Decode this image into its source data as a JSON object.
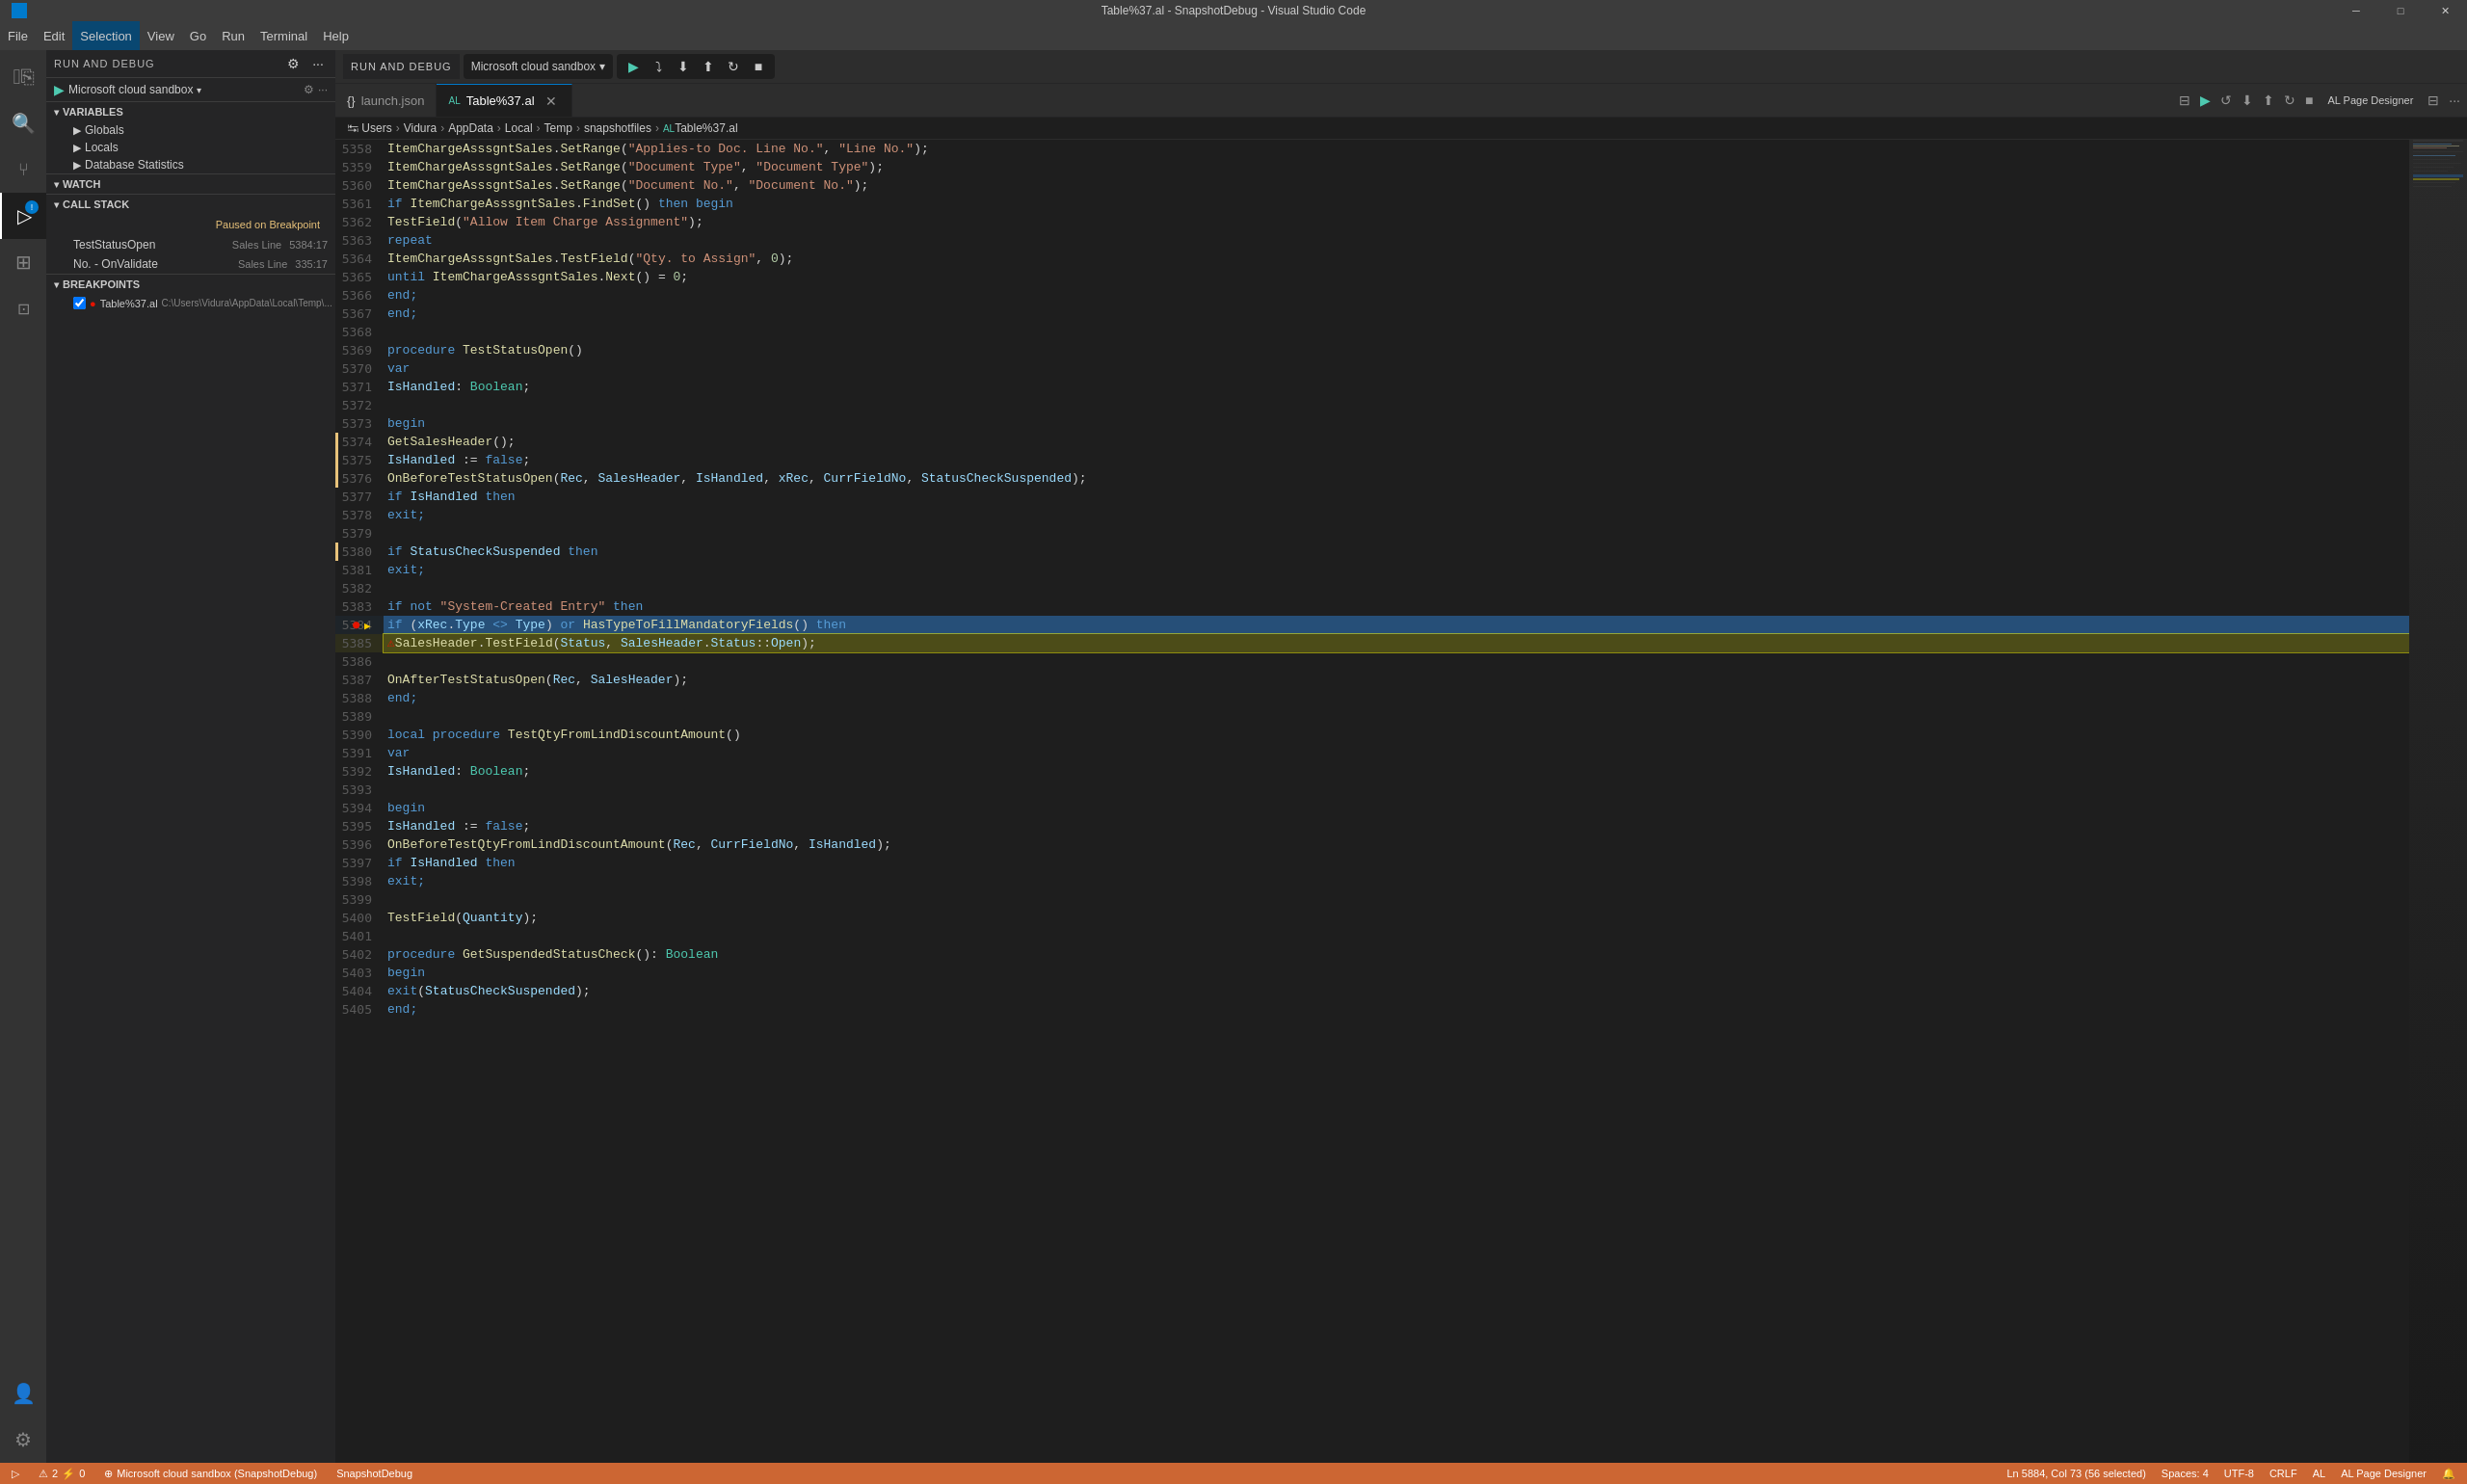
{
  "titleBar": {
    "title": "Table%37.al - SnapshotDebug - Visual Studio Code",
    "controls": [
      "minimize",
      "maximize",
      "close"
    ]
  },
  "menuBar": {
    "items": [
      "File",
      "Edit",
      "Selection",
      "View",
      "Go",
      "Run",
      "Terminal",
      "Help"
    ],
    "activeItem": "Selection"
  },
  "activityBar": {
    "items": [
      {
        "name": "explorer",
        "icon": "⎘",
        "active": false
      },
      {
        "name": "search",
        "icon": "🔍",
        "active": false
      },
      {
        "name": "source-control",
        "icon": "⑂",
        "active": false
      },
      {
        "name": "debug",
        "icon": "▷",
        "active": true
      },
      {
        "name": "extensions",
        "icon": "⊞",
        "active": false
      },
      {
        "name": "al-page-designer",
        "icon": "⊡",
        "active": false
      }
    ],
    "bottomItems": [
      {
        "name": "account",
        "icon": "👤"
      },
      {
        "name": "settings",
        "icon": "⚙"
      }
    ]
  },
  "sidebar": {
    "header": "RUN AND DEBUG",
    "config": "Microsoft cloud sandbox",
    "variables": {
      "title": "VARIABLES",
      "items": [
        {
          "name": "Globals",
          "expanded": false
        },
        {
          "name": "Locals",
          "expanded": false
        },
        {
          "name": "Database Statistics",
          "expanded": false
        }
      ]
    },
    "watch": {
      "title": "WATCH",
      "items": []
    },
    "callStack": {
      "title": "CALL STACK",
      "pausedLabel": "Paused on Breakpoint",
      "items": [
        {
          "funcName": "TestStatusOpen",
          "file": "Sales Line",
          "line": "5384:17"
        },
        {
          "funcName": "No. - OnValidate",
          "file": "Sales Line",
          "line": "335:17"
        }
      ]
    },
    "breakpoints": {
      "title": "BREAKPOINTS",
      "items": [
        {
          "name": "Table%37.al",
          "path": "C:\\Users\\Vidura\\AppData\\Local\\Temp\\...",
          "enabled": true,
          "hasError": true
        }
      ]
    }
  },
  "editor": {
    "tabs": [
      {
        "name": "launch.json",
        "icon": "{ }",
        "active": false
      },
      {
        "name": "Table%37.al",
        "icon": "AL",
        "active": true,
        "modified": false
      }
    ],
    "breadcrumb": [
      "Users",
      "Vidura",
      "AppData",
      "Local",
      "Temp",
      "snapshotfiles",
      "Table%37.al"
    ],
    "lines": [
      {
        "num": 5358,
        "text": "    ItemChargeAsssgntSales.SetRange(\"Applies-to Doc. Line No.\", \"Line No.\");"
      },
      {
        "num": 5359,
        "text": "    ItemChargeAsssgntSales.SetRange(\"Document Type\", \"Document Type\");"
      },
      {
        "num": 5360,
        "text": "    ItemChargeAsssgntSales.SetRange(\"Document No.\", \"Document No.\");"
      },
      {
        "num": 5361,
        "text": "    if ItemChargeAsssgntSales.FindSet() then begin"
      },
      {
        "num": 5362,
        "text": "        TestField(\"Allow Item Charge Assignment\");"
      },
      {
        "num": 5363,
        "text": "        repeat"
      },
      {
        "num": 5364,
        "text": "            ItemChargeAsssgntSales.TestField(\"Qty. to Assign\", 0);"
      },
      {
        "num": 5365,
        "text": "        until ItemChargeAsssgntSales.Next() = 0;"
      },
      {
        "num": 5366,
        "text": "    end;"
      },
      {
        "num": 5367,
        "text": "end;"
      },
      {
        "num": 5368,
        "text": ""
      },
      {
        "num": 5369,
        "text": "procedure TestStatusOpen()"
      },
      {
        "num": 5370,
        "text": "var"
      },
      {
        "num": 5371,
        "text": "    IsHandled: Boolean;"
      },
      {
        "num": 5372,
        "text": ""
      },
      {
        "num": 5373,
        "text": "begin"
      },
      {
        "num": 5374,
        "text": "    GetSalesHeader();"
      },
      {
        "num": 5375,
        "text": "    IsHandled := false;"
      },
      {
        "num": 5376,
        "text": "    OnBeforeTestStatusOpen(Rec, SalesHeader, IsHandled, xRec, CurrFieldNo, StatusCheckSuspended);"
      },
      {
        "num": 5377,
        "text": "    if IsHandled then"
      },
      {
        "num": 5378,
        "text": "        exit;"
      },
      {
        "num": 5379,
        "text": ""
      },
      {
        "num": 5380,
        "text": "    if StatusCheckSuspended then"
      },
      {
        "num": 5381,
        "text": "        exit;"
      },
      {
        "num": 5382,
        "text": ""
      },
      {
        "num": 5383,
        "text": "    if not \"System-Created Entry\" then"
      },
      {
        "num": 5384,
        "text": "        if (xRec.Type <> Type) or HasTypeToFillMandatoryFields() then",
        "breakpoint": true,
        "arrow": true,
        "highlight": true
      },
      {
        "num": 5385,
        "text": "            SalesHeader.TestField(Status, SalesHeader.Status::Open);"
      },
      {
        "num": 5386,
        "text": ""
      },
      {
        "num": 5387,
        "text": "    OnAfterTestStatusOpen(Rec, SalesHeader);"
      },
      {
        "num": 5388,
        "text": "end;"
      },
      {
        "num": 5389,
        "text": ""
      },
      {
        "num": 5390,
        "text": "local procedure TestQtyFromLindDiscountAmount()"
      },
      {
        "num": 5391,
        "text": "var"
      },
      {
        "num": 5392,
        "text": "    IsHandled: Boolean;"
      },
      {
        "num": 5393,
        "text": ""
      },
      {
        "num": 5394,
        "text": "begin"
      },
      {
        "num": 5395,
        "text": "    IsHandled := false;"
      },
      {
        "num": 5396,
        "text": "    OnBeforeTestQtyFromLindDiscountAmount(Rec, CurrFieldNo, IsHandled);"
      },
      {
        "num": 5397,
        "text": "    if IsHandled then"
      },
      {
        "num": 5398,
        "text": "        exit;"
      },
      {
        "num": 5399,
        "text": ""
      },
      {
        "num": 5400,
        "text": "    TestField(Quantity);"
      },
      {
        "num": 5401,
        "text": ""
      },
      {
        "num": 5402,
        "text": "procedure GetSuspendedStatusCheck(): Boolean"
      },
      {
        "num": 5403,
        "text": "begin"
      },
      {
        "num": 5404,
        "text": "    exit(StatusCheckSuspended);"
      },
      {
        "num": 5405,
        "text": "end;"
      }
    ],
    "highlightedLineContent": "            ⚠SalesHeader.TestField(Status, SalesHeader.Status::Open);"
  },
  "statusBar": {
    "left": [
      {
        "icon": "▷",
        "text": "Microsoft cloud sandbox (SnapshotDebug)"
      },
      {
        "icon": "⚠",
        "text": "2"
      },
      {
        "icon": "⚡",
        "text": "0"
      },
      {
        "icon": "⊕",
        "text": "SnapshotDebug"
      }
    ],
    "right": [
      {
        "text": "Ln 5884, Col 73 (56 selected)"
      },
      {
        "text": "Spaces: 4"
      },
      {
        "text": "UTF-8"
      },
      {
        "text": "CRLF"
      },
      {
        "text": "AL"
      },
      {
        "text": "AL Page Designer"
      }
    ]
  }
}
